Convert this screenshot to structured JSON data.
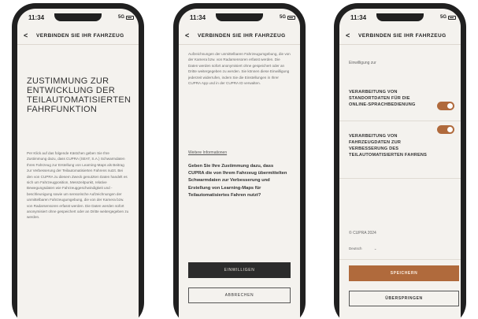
{
  "status_bar": {
    "time": "11:34",
    "network": "5G"
  },
  "header": {
    "title": "VERBINDEN SIE IHR FAHRZEUG",
    "back_glyph": "<"
  },
  "screen1": {
    "title": "ZUSTIMMUNG ZUR ENTWICKLUNG DER TEILAUTOMATISIERTEN FAHRFUNKTION",
    "body": "Per Klick auf das folgende Kästchen geben Sie Ihre Zustimmung dazu, dass CUPRA (SEAT, S.A.) Schwarmdaten Ihres Fahrzeug zur Erstellung von Learning-Maps als Beitrag zur Verbesserung der Teilautomatisierten Fahrens nutzt. Bei den von CUPRA zu diesem Zweck genutzten Daten handelt es sich um Fahrzeugposition, Messzeitpunkt, relative Bewegungsdaten wie Fahrzeuggeschwindigkeit und -beschleunigung sowie um sensorische Aufzeichnungen der unmittelbaren Fahrzeugumgebung, die von der Kamera bzw. von Radarsensoren erfasst werden. Die Daten werden sofort anonymisiert ohne gespeichert oder an Dritte weitergegeben zu werden."
  },
  "screen2": {
    "body": "Aufzeichnungen der unmittelbaren Fahrzeugumgebung, die von der Kamera bzw. von Radarsensoren erfasst werden. Die Daten werden sofort anonymisiert ohne gespeichert oder an Dritte weitergegeben zu werden. Sie können diese Einwilligung jederzeit widerrufen, indem Sie die Einstellungen in Ihrer CUPRA App und in der CUPRA ID verwalten.",
    "link": "Weitere Informationen",
    "question": "Geben Sie Ihre Zustimmung dazu, dass CUPRA die von Ihrem Fahrzeug übermittelten Schwarmdaten zur Verbesserung und Erstellung von Learning-Maps für Teilautomatisiertes Fahren nutzt?",
    "consent_button": "EINWILLIGEN",
    "cancel_button": "ABBRECHEN"
  },
  "screen3": {
    "intro": "Einwilligung zur",
    "options": [
      {
        "label": "VERARBEITUNG VON STANDORTDATEN FÜR DIE ONLINE-SPRACHBEDIENUNG",
        "enabled": true
      },
      {
        "label": "VERARBEITUNG VON FAHRZEUGDATEN ZUR VERBESSERUNG DES TEILAUTOMATISIERTEN FAHRENS",
        "enabled": true
      }
    ],
    "copyright": "© CUPRA 2024",
    "language": "Deutsch",
    "save_button": "SPEICHERN",
    "skip_button": "ÜBERSPRINGEN"
  },
  "colors": {
    "accent": "#b06a3c",
    "frame": "#202020",
    "screen_bg": "#f4f2ee",
    "dark_button": "#2c2c2c"
  }
}
